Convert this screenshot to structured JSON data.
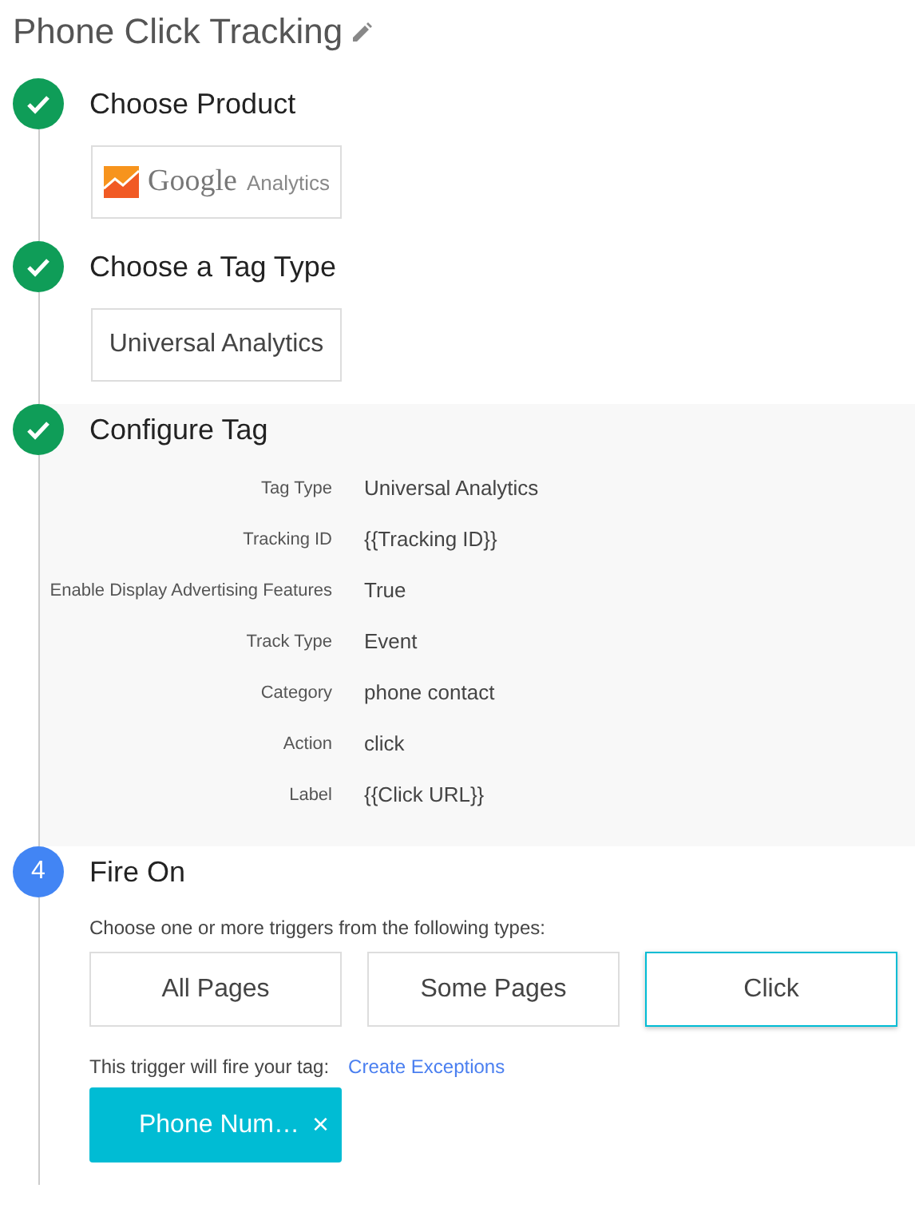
{
  "title": "Phone Click Tracking",
  "steps": [
    {
      "completed": true,
      "title": "Choose Product",
      "kind": "product",
      "product": {
        "brand": "Google",
        "name": "Analytics"
      }
    },
    {
      "completed": true,
      "title": "Choose a Tag Type",
      "kind": "tag_type",
      "tag_type": "Universal Analytics"
    },
    {
      "completed": true,
      "title": "Configure Tag",
      "kind": "config",
      "fields": [
        {
          "label": "Tag Type",
          "value": "Universal Analytics"
        },
        {
          "label": "Tracking ID",
          "value": "{{Tracking ID}}"
        },
        {
          "label": "Enable Display Advertising Features",
          "value": "True"
        },
        {
          "label": "Track Type",
          "value": "Event"
        },
        {
          "label": "Category",
          "value": "phone contact"
        },
        {
          "label": "Action",
          "value": "click"
        },
        {
          "label": "Label",
          "value": "{{Click URL}}"
        }
      ]
    },
    {
      "completed": false,
      "number": "4",
      "title": "Fire On",
      "kind": "triggers",
      "prompt": "Choose one or more triggers from the following types:",
      "trigger_types": [
        {
          "label": "All Pages",
          "selected": false
        },
        {
          "label": "Some Pages",
          "selected": false
        },
        {
          "label": "Click",
          "selected": true
        }
      ],
      "fire_text": "This trigger will fire your tag:",
      "exceptions_link": "Create Exceptions",
      "chips": [
        {
          "label": "Phone Num…",
          "close": "×"
        }
      ]
    }
  ]
}
